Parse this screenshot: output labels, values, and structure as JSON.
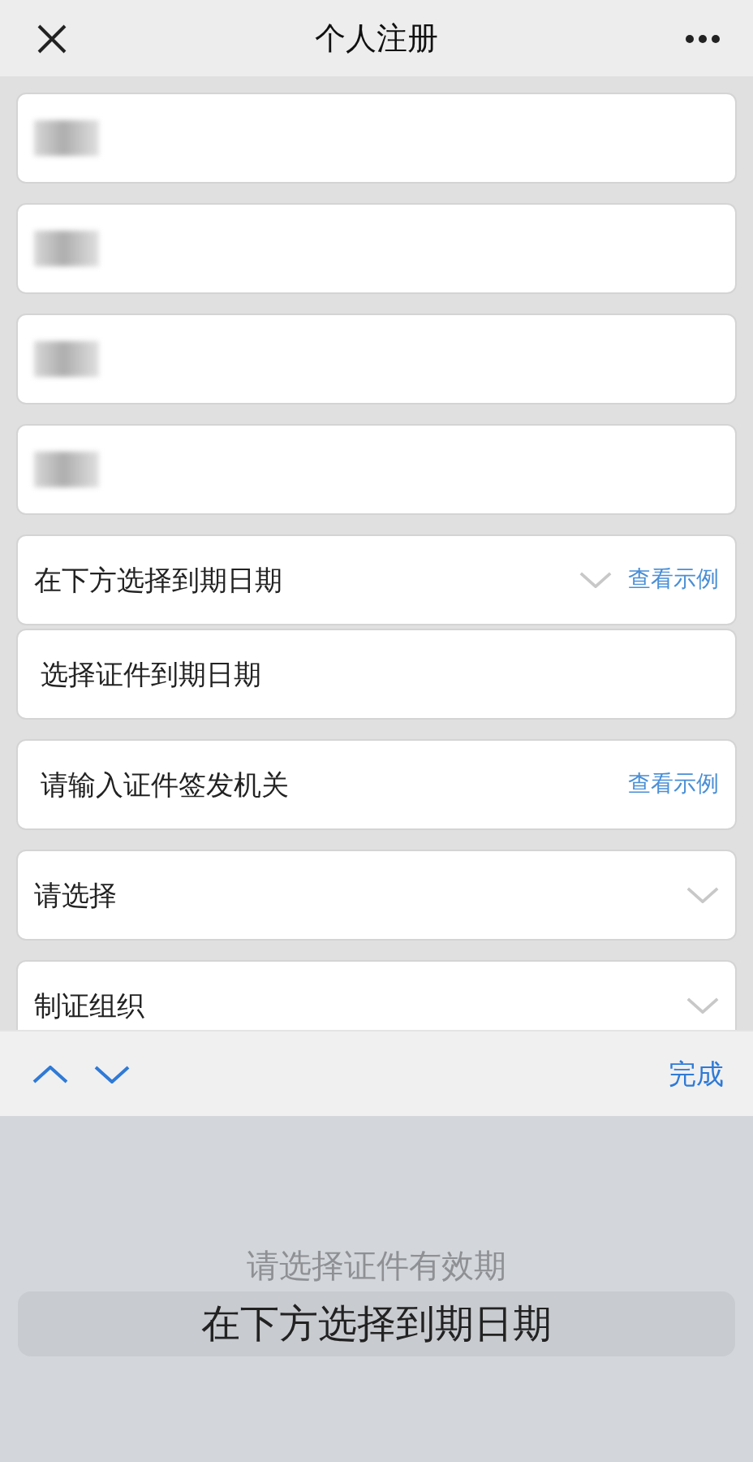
{
  "header": {
    "title": "个人注册"
  },
  "fields": [
    {
      "kind": "redacted"
    },
    {
      "kind": "redacted"
    },
    {
      "kind": "redacted"
    },
    {
      "kind": "redacted"
    },
    {
      "kind": "select",
      "value": "在下方选择到期日期",
      "link": "查看示例"
    },
    {
      "kind": "input",
      "value": "选择证件到期日期"
    },
    {
      "kind": "input",
      "value": "请输入证件签发机关",
      "link": "查看示例"
    },
    {
      "kind": "select",
      "value": "请选择"
    },
    {
      "kind": "select",
      "value": "制证组织"
    }
  ],
  "toolbar": {
    "done": "完成"
  },
  "picker": {
    "options": [
      {
        "label": "请选择证件有效期",
        "selected": false
      },
      {
        "label": "在下方选择到期日期",
        "selected": true
      }
    ]
  }
}
